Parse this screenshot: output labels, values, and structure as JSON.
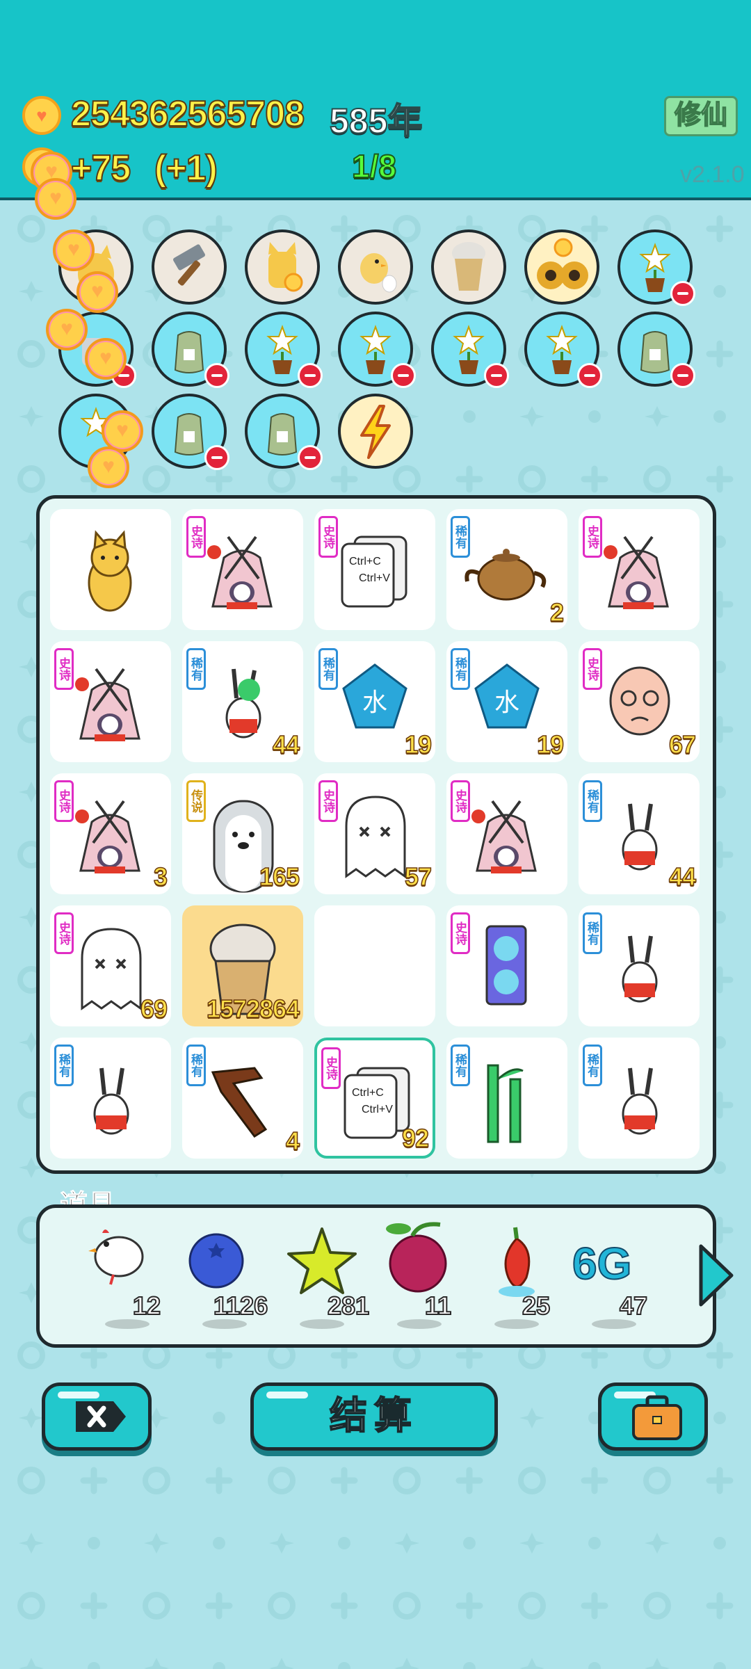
{
  "header": {
    "coins": "254362565708",
    "year": "585年",
    "income": "+75",
    "income_bonus": "(+1)",
    "progress": "1/8",
    "cultivate_button": "修仙",
    "version": "v2.1.0"
  },
  "top_slots": [
    "cat",
    "hammer",
    "cat-coin",
    "chick",
    "bubble-tea-cup",
    "owl-pair",
    "flower-pot",
    "robot-coin",
    "rice-bag",
    "flower-pot",
    "flower-pot",
    "flower-pot",
    "flower-pot",
    "rice-bag",
    "flower-pot",
    "rice-bag",
    "rice-bag",
    "lightning-bolt"
  ],
  "board": {
    "cells": [
      {
        "item": "cat",
        "tag": "",
        "count": ""
      },
      {
        "item": "rabbit-tent",
        "tag": "史诗",
        "count": ""
      },
      {
        "item": "ctrl-c-v-cards",
        "tag": "史诗",
        "count": ""
      },
      {
        "item": "teapot",
        "tag": "稀有",
        "count": "2"
      },
      {
        "item": "rabbit-tent",
        "tag": "史诗",
        "count": ""
      },
      {
        "item": "rabbit-tent",
        "tag": "史诗",
        "count": ""
      },
      {
        "item": "rabbit-clover",
        "tag": "稀有",
        "count": "44"
      },
      {
        "item": "water-pentagon",
        "tag": "稀有",
        "count": "19"
      },
      {
        "item": "water-pentagon",
        "tag": "稀有",
        "count": "19"
      },
      {
        "item": "bald-man-face",
        "tag": "史诗",
        "count": "67"
      },
      {
        "item": "rabbit-tent",
        "tag": "史诗",
        "count": "3"
      },
      {
        "item": "husky-dog",
        "tag": "传说",
        "count": "165"
      },
      {
        "item": "ghost",
        "tag": "史诗",
        "count": "57"
      },
      {
        "item": "rabbit-tent",
        "tag": "史诗",
        "count": ""
      },
      {
        "item": "rabbit-red",
        "tag": "稀有",
        "count": "44"
      },
      {
        "item": "ghost",
        "tag": "史诗",
        "count": "69"
      },
      {
        "item": "bubble-tea-cup",
        "tag": "",
        "count": "1572864"
      },
      {
        "item": "",
        "tag": "",
        "count": ""
      },
      {
        "item": "graphics-card",
        "tag": "史诗",
        "count": ""
      },
      {
        "item": "rabbit-red",
        "tag": "稀有",
        "count": ""
      },
      {
        "item": "rabbit-red",
        "tag": "稀有",
        "count": ""
      },
      {
        "item": "pointing-finger",
        "tag": "稀有",
        "count": "4"
      },
      {
        "item": "ctrl-c-v-cards",
        "tag": "史诗",
        "count": "92"
      },
      {
        "item": "bamboo",
        "tag": "稀有",
        "count": ""
      },
      {
        "item": "rabbit-red",
        "tag": "稀有",
        "count": ""
      }
    ],
    "water_char": "水",
    "ctrl_c": "Ctrl+C",
    "ctrl_v": "Ctrl+V"
  },
  "props": {
    "label": "道具",
    "items": [
      {
        "icon": "white-bird-icon",
        "count": "12"
      },
      {
        "icon": "blueberry-icon",
        "count": "1126"
      },
      {
        "icon": "star-icon",
        "count": "281"
      },
      {
        "icon": "lychee-icon",
        "count": "11"
      },
      {
        "icon": "chili-icon",
        "count": "25"
      },
      {
        "icon": "6g-icon",
        "count": "47"
      }
    ],
    "sixg_text": "6G"
  },
  "buttons": {
    "settle": "结算"
  },
  "colors": {
    "header_bg": "#17c4c8",
    "page_bg": "#aee3ea",
    "epic": "#e02cc4",
    "rare": "#2c8fd8",
    "legend": "#e0b21c"
  }
}
